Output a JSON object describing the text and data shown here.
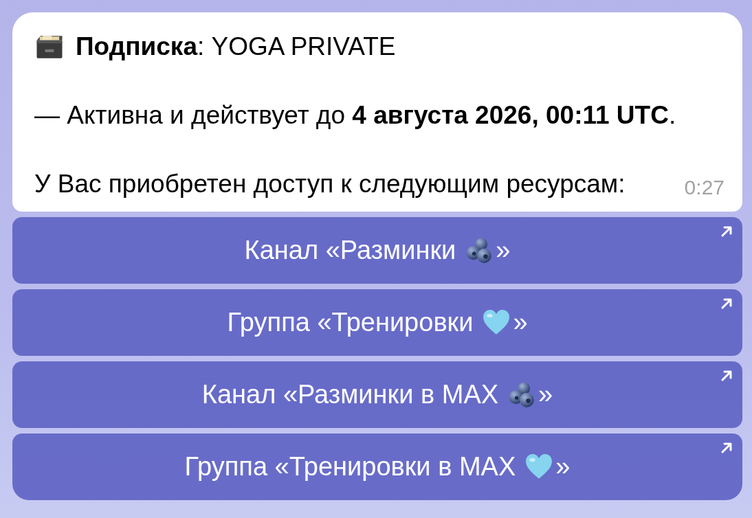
{
  "message": {
    "header": "**Подписка**: YOGA PRIVATE",
    "lines": [
      "— Активна и действует до **4 августа 2026, 00:11 UTC**.",
      "У Вас приобретен доступ к следующим ресурсам:"
    ],
    "time": "0:27"
  },
  "buttons": [
    {
      "text_before": "Канал «Разминки",
      "kind": "berries",
      "text_after": "»"
    },
    {
      "text_before": "Группа «Тренировки",
      "kind": "heart",
      "text_after": "»"
    },
    {
      "text_before": "Канал «Разминки в MAX",
      "kind": "berries",
      "text_after": "»"
    },
    {
      "text_before": "Группа «Тренировки в MAX",
      "kind": "heart",
      "text_after": "»"
    }
  ]
}
